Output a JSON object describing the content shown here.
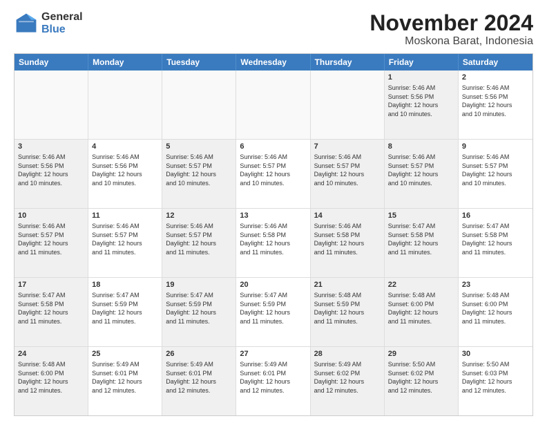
{
  "logo": {
    "general": "General",
    "blue": "Blue"
  },
  "header": {
    "title": "November 2024",
    "location": "Moskona Barat, Indonesia"
  },
  "weekdays": [
    "Sunday",
    "Monday",
    "Tuesday",
    "Wednesday",
    "Thursday",
    "Friday",
    "Saturday"
  ],
  "rows": [
    [
      {
        "day": "",
        "info": "",
        "empty": true
      },
      {
        "day": "",
        "info": "",
        "empty": true
      },
      {
        "day": "",
        "info": "",
        "empty": true
      },
      {
        "day": "",
        "info": "",
        "empty": true
      },
      {
        "day": "",
        "info": "",
        "empty": true
      },
      {
        "day": "1",
        "info": "Sunrise: 5:46 AM\nSunset: 5:56 PM\nDaylight: 12 hours\nand 10 minutes.",
        "shaded": true
      },
      {
        "day": "2",
        "info": "Sunrise: 5:46 AM\nSunset: 5:56 PM\nDaylight: 12 hours\nand 10 minutes."
      }
    ],
    [
      {
        "day": "3",
        "info": "Sunrise: 5:46 AM\nSunset: 5:56 PM\nDaylight: 12 hours\nand 10 minutes.",
        "shaded": true
      },
      {
        "day": "4",
        "info": "Sunrise: 5:46 AM\nSunset: 5:56 PM\nDaylight: 12 hours\nand 10 minutes."
      },
      {
        "day": "5",
        "info": "Sunrise: 5:46 AM\nSunset: 5:57 PM\nDaylight: 12 hours\nand 10 minutes.",
        "shaded": true
      },
      {
        "day": "6",
        "info": "Sunrise: 5:46 AM\nSunset: 5:57 PM\nDaylight: 12 hours\nand 10 minutes."
      },
      {
        "day": "7",
        "info": "Sunrise: 5:46 AM\nSunset: 5:57 PM\nDaylight: 12 hours\nand 10 minutes.",
        "shaded": true
      },
      {
        "day": "8",
        "info": "Sunrise: 5:46 AM\nSunset: 5:57 PM\nDaylight: 12 hours\nand 10 minutes.",
        "shaded": true
      },
      {
        "day": "9",
        "info": "Sunrise: 5:46 AM\nSunset: 5:57 PM\nDaylight: 12 hours\nand 10 minutes."
      }
    ],
    [
      {
        "day": "10",
        "info": "Sunrise: 5:46 AM\nSunset: 5:57 PM\nDaylight: 12 hours\nand 11 minutes.",
        "shaded": true
      },
      {
        "day": "11",
        "info": "Sunrise: 5:46 AM\nSunset: 5:57 PM\nDaylight: 12 hours\nand 11 minutes."
      },
      {
        "day": "12",
        "info": "Sunrise: 5:46 AM\nSunset: 5:57 PM\nDaylight: 12 hours\nand 11 minutes.",
        "shaded": true
      },
      {
        "day": "13",
        "info": "Sunrise: 5:46 AM\nSunset: 5:58 PM\nDaylight: 12 hours\nand 11 minutes."
      },
      {
        "day": "14",
        "info": "Sunrise: 5:46 AM\nSunset: 5:58 PM\nDaylight: 12 hours\nand 11 minutes.",
        "shaded": true
      },
      {
        "day": "15",
        "info": "Sunrise: 5:47 AM\nSunset: 5:58 PM\nDaylight: 12 hours\nand 11 minutes.",
        "shaded": true
      },
      {
        "day": "16",
        "info": "Sunrise: 5:47 AM\nSunset: 5:58 PM\nDaylight: 12 hours\nand 11 minutes."
      }
    ],
    [
      {
        "day": "17",
        "info": "Sunrise: 5:47 AM\nSunset: 5:58 PM\nDaylight: 12 hours\nand 11 minutes.",
        "shaded": true
      },
      {
        "day": "18",
        "info": "Sunrise: 5:47 AM\nSunset: 5:59 PM\nDaylight: 12 hours\nand 11 minutes."
      },
      {
        "day": "19",
        "info": "Sunrise: 5:47 AM\nSunset: 5:59 PM\nDaylight: 12 hours\nand 11 minutes.",
        "shaded": true
      },
      {
        "day": "20",
        "info": "Sunrise: 5:47 AM\nSunset: 5:59 PM\nDaylight: 12 hours\nand 11 minutes."
      },
      {
        "day": "21",
        "info": "Sunrise: 5:48 AM\nSunset: 5:59 PM\nDaylight: 12 hours\nand 11 minutes.",
        "shaded": true
      },
      {
        "day": "22",
        "info": "Sunrise: 5:48 AM\nSunset: 6:00 PM\nDaylight: 12 hours\nand 11 minutes.",
        "shaded": true
      },
      {
        "day": "23",
        "info": "Sunrise: 5:48 AM\nSunset: 6:00 PM\nDaylight: 12 hours\nand 11 minutes."
      }
    ],
    [
      {
        "day": "24",
        "info": "Sunrise: 5:48 AM\nSunset: 6:00 PM\nDaylight: 12 hours\nand 12 minutes.",
        "shaded": true
      },
      {
        "day": "25",
        "info": "Sunrise: 5:49 AM\nSunset: 6:01 PM\nDaylight: 12 hours\nand 12 minutes."
      },
      {
        "day": "26",
        "info": "Sunrise: 5:49 AM\nSunset: 6:01 PM\nDaylight: 12 hours\nand 12 minutes.",
        "shaded": true
      },
      {
        "day": "27",
        "info": "Sunrise: 5:49 AM\nSunset: 6:01 PM\nDaylight: 12 hours\nand 12 minutes."
      },
      {
        "day": "28",
        "info": "Sunrise: 5:49 AM\nSunset: 6:02 PM\nDaylight: 12 hours\nand 12 minutes.",
        "shaded": true
      },
      {
        "day": "29",
        "info": "Sunrise: 5:50 AM\nSunset: 6:02 PM\nDaylight: 12 hours\nand 12 minutes.",
        "shaded": true
      },
      {
        "day": "30",
        "info": "Sunrise: 5:50 AM\nSunset: 6:03 PM\nDaylight: 12 hours\nand 12 minutes."
      }
    ]
  ]
}
